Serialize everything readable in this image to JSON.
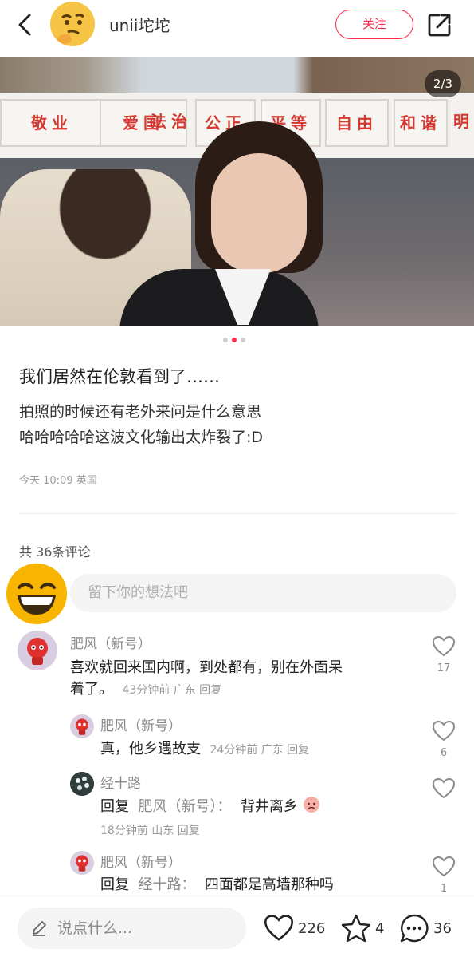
{
  "header": {
    "username": "unii坨坨",
    "follow_label": "关注",
    "icons": {
      "back": "chevron-left-icon",
      "share": "share-icon"
    }
  },
  "photo": {
    "page_counter": "2/3",
    "wall_words": [
      "敬业",
      "爱国",
      "法治",
      "公正",
      "平等",
      "自由",
      "和谐",
      "明"
    ],
    "dots_total": 3,
    "dots_active": 2
  },
  "post": {
    "title": "我们居然在伦敦看到了……",
    "body_line1": "拍照的时候还有老外来问是什么意思",
    "body_line2": "哈哈哈哈哈这波文化输出太炸裂了:D",
    "meta": "今天 10:09 英国"
  },
  "comments_header": "共 36条评论",
  "comment_input_placeholder": "留下你的想法吧",
  "comments": [
    {
      "name": "肥风（新号）",
      "text": "喜欢就回来国内啊，到处都有，别在外面呆着了。",
      "text_line1": "喜欢就回来国内啊，到处都有，别在外面呆",
      "text_line2": "着了。",
      "meta": "43分钟前  广东  回复",
      "likes": "17"
    },
    {
      "name": "肥风（新号）",
      "text": "真，他乡遇故支",
      "meta": "24分钟前  广东  回复",
      "likes": "6"
    },
    {
      "name": "经十路",
      "reply_prefix": "回复",
      "reply_target": "肥风（新号）：",
      "text": "背井离乡",
      "meta": "18分钟前  山东  回复",
      "likes": ""
    },
    {
      "name": "肥风（新号）",
      "reply_prefix": "回复",
      "reply_target": "经十路：",
      "text": "四面都是高墙那种吗",
      "likes": "1"
    }
  ],
  "bottom_bar": {
    "say_placeholder": "说点什么...",
    "likes": "226",
    "favorites": "4",
    "comments": "36"
  },
  "colors": {
    "accent": "#ff2a4b",
    "muted": "#8a8a8a"
  }
}
